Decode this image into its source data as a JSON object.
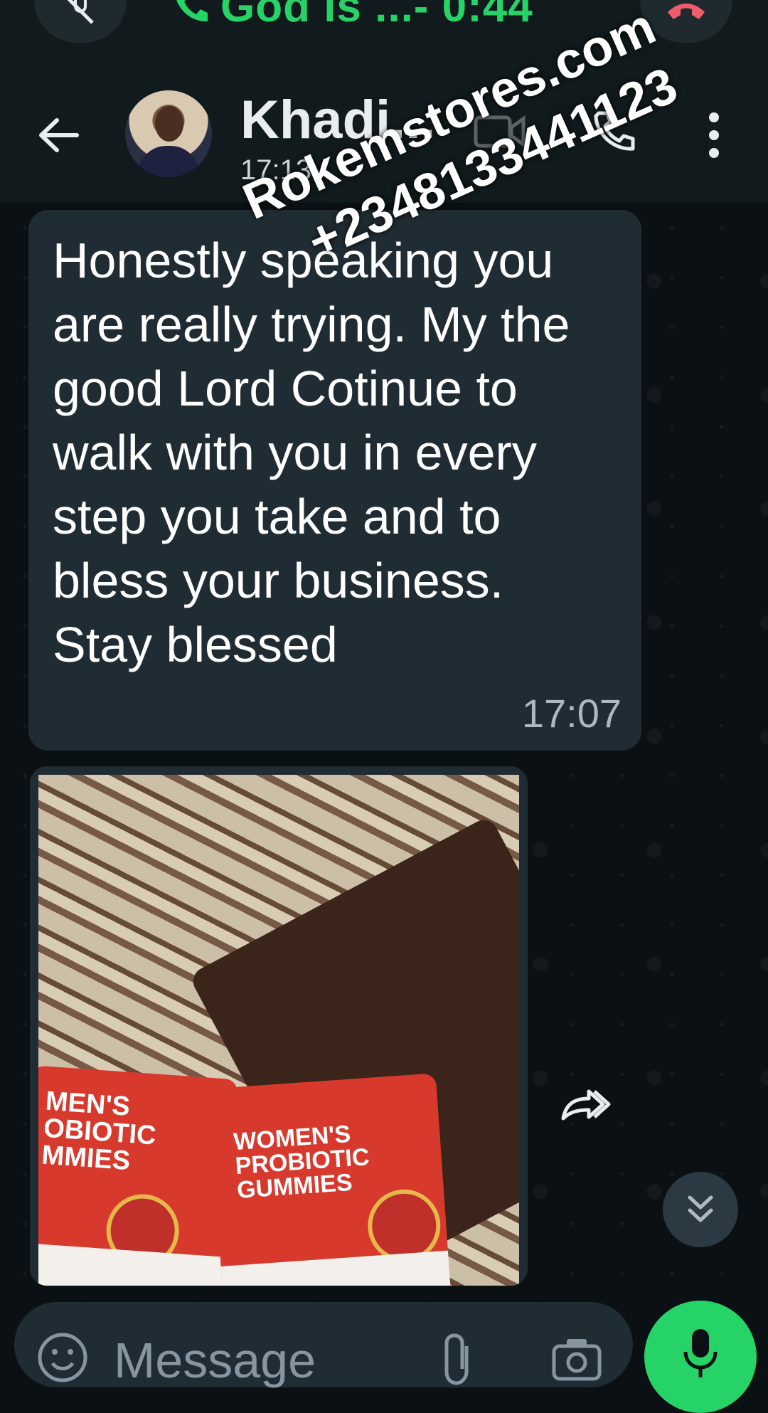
{
  "call_banner": {
    "text": "God is ...- 0:44",
    "accent_color": "#25d366"
  },
  "header": {
    "contact_name": "Khadi...",
    "last_seen": "17:13"
  },
  "messages": [
    {
      "text": "Honestly speaking you are really trying. My the good Lord Cotinue to walk with you in every step you take and to bless your business. Stay blessed",
      "time": "17:07"
    }
  ],
  "image_message": {
    "pack_left_label": "MEN'S\nOBIOTIC\nMMIES",
    "pack_right_label": "WOMEN'S\nPROBIOTIC\nGUMMIES"
  },
  "watermark": {
    "line1": "Rokemstores.com",
    "line2": "+2348133441123"
  },
  "input": {
    "placeholder": "Message"
  },
  "icons": [
    "mic-off-icon",
    "call-end-icon",
    "back-arrow-icon",
    "video-call-icon",
    "voice-call-icon",
    "more-menu-icon",
    "forward-icon",
    "scroll-down-icon",
    "emoji-icon",
    "attach-icon",
    "camera-icon",
    "mic-icon"
  ]
}
